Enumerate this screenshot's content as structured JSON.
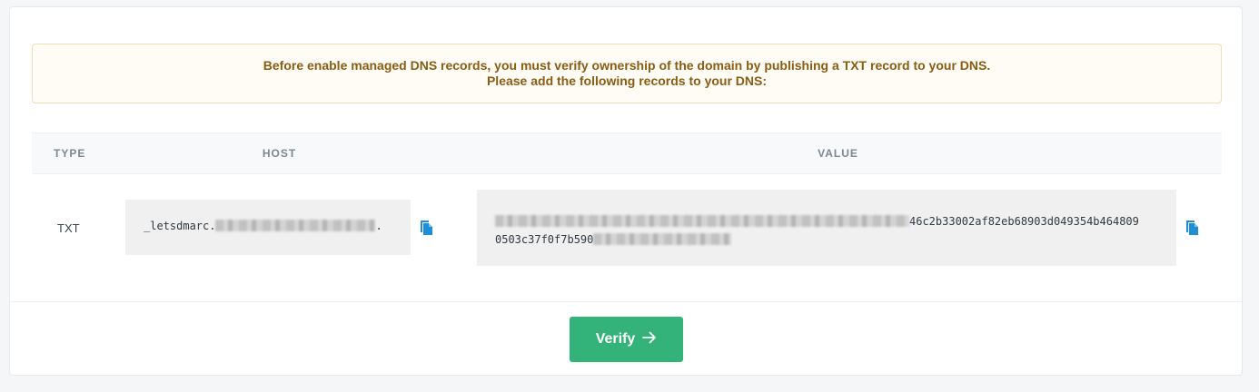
{
  "notice": {
    "line1": "Before enable managed DNS records, you must verify ownership of the domain by publishing a TXT record to your DNS.",
    "line2": "Please add the following records to your DNS:"
  },
  "table": {
    "headers": {
      "type": "TYPE",
      "host": "HOST",
      "value": "VALUE"
    },
    "rows": [
      {
        "type": "TXT",
        "host_prefix": "_letsdmarc.",
        "host_suffix": ".",
        "value_line1_visible": "46c2b33002af82eb68903d049354b464809",
        "value_line2_visible": "0503c37f0f7b590"
      }
    ]
  },
  "icons": {
    "copy_host": "copy-icon",
    "copy_value": "copy-icon",
    "verify_arrow": "arrow-right-icon"
  },
  "actions": {
    "verify_label": "Verify"
  },
  "colors": {
    "notice_text": "#8a5c12",
    "notice_border": "#f3dcb6",
    "accent_blue": "#1e8fd6",
    "verify_green": "#33b27a"
  }
}
